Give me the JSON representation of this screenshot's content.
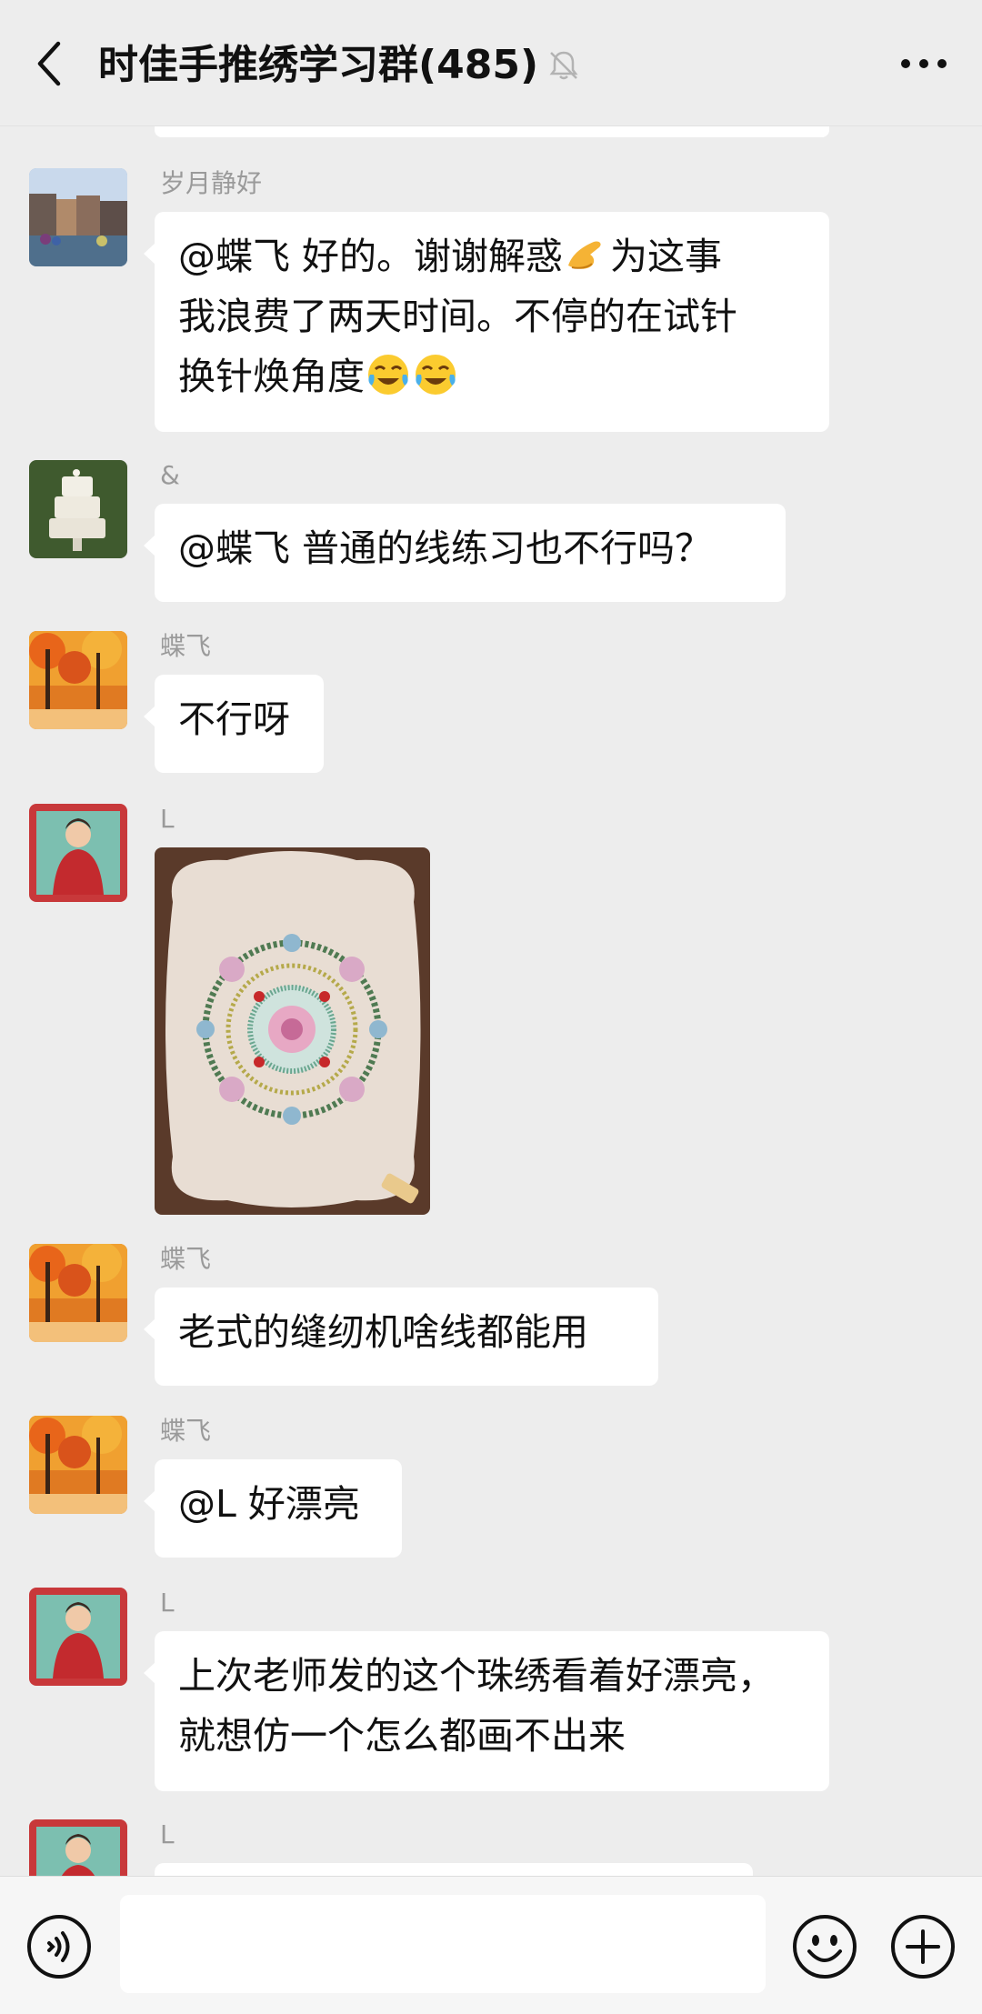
{
  "header": {
    "title": "时佳手推绣学习群(485)",
    "back_icon": "chevron-left-icon",
    "mute_icon": "bell-muted-icon",
    "more_icon": "more-horizontal-icon"
  },
  "messages": [
    {
      "sender": "岁月静好",
      "avatar": "canal-town-photo",
      "lines": [
        "@蝶飞  好的。谢谢解惑",
        "为这事",
        "我浪费了两天时间。不停的在试针",
        "换针焕角度"
      ],
      "emojis": [
        "pointing-hand-emoji",
        "crying-laughing-emoji"
      ]
    },
    {
      "sender": "&",
      "avatar": "cake-photo",
      "text": "@蝶飞  普通的线练习也不行吗？"
    },
    {
      "sender": "蝶飞",
      "avatar": "autumn-trees-photo",
      "text": "不行呀"
    },
    {
      "sender": "L",
      "avatar": "woman-red-dress-photo",
      "image": "bead-embroidery-fan-photo"
    },
    {
      "sender": "蝶飞",
      "avatar": "autumn-trees-photo",
      "text": "老式的缝纫机啥线都能用"
    },
    {
      "sender": "蝶飞",
      "avatar": "autumn-trees-photo",
      "text": "@L  好漂亮"
    },
    {
      "sender": "L",
      "avatar": "woman-red-dress-photo",
      "lines": [
        "上次老师发的这个珠绣看着好漂亮，",
        "就想仿一个怎么都画不出来"
      ]
    },
    {
      "sender": "L",
      "avatar": "woman-red-dress-photo"
    }
  ],
  "input_bar": {
    "voice_icon": "voice-icon",
    "emoji_icon": "emoji-icon",
    "plus_icon": "plus-icon",
    "value": ""
  },
  "colors": {
    "background": "#ededed",
    "bubble": "#ffffff",
    "sender_name": "#9a9a9a",
    "text": "#111111"
  }
}
